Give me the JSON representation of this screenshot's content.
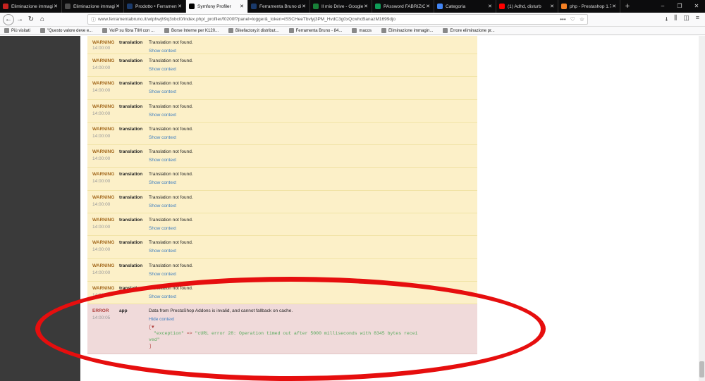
{
  "browser": {
    "tabs": [
      {
        "title": "Eliminazione immagini",
        "color": "#c5221f"
      },
      {
        "title": "Eliminazione immagini",
        "color": "#4b4b4b"
      },
      {
        "title": "Prodotto • Ferramenta",
        "color": "#1a3a6b"
      },
      {
        "title": "Symfony Profiler",
        "color": "#000000",
        "active": true
      },
      {
        "title": "Ferramenta Bruno di",
        "color": "#1a3a6b"
      },
      {
        "title": "Il mio Drive - Google",
        "color": "#188038"
      },
      {
        "title": "PAssword FABRIZIO",
        "color": "#0f9d58"
      },
      {
        "title": "Categoria",
        "color": "#4285f4"
      },
      {
        "title": "(1) Adhd, disturb",
        "color": "#ff0000"
      },
      {
        "title": "php - Prestashop 1.7",
        "color": "#f48024"
      }
    ],
    "new_tab": "+",
    "url": "www.ferramentabruno.it/wtphwjh9q3xbcl0/index.php/_profiler/f0200f?panel=logger&_token=iSSCHeeTbvlyj3PM_HvdC3g0xQcwhcBanazM1699djo",
    "url_actions": [
      "•••",
      "♡",
      "☆"
    ],
    "bookmarks": [
      "Più visitati",
      "\"Questo valore deve e...",
      "VoIP su fibra TIM con ...",
      "Borse Interne per K120...",
      "Bikefactory.it distribut...",
      "Ferramenta Bruno - 84...",
      "macos",
      "Eliminazione immagin...",
      "Errore eliminazione pr..."
    ]
  },
  "log": {
    "warnings": [
      {
        "level": "WARNING",
        "time": "14:00:00",
        "channel": "translation",
        "message": "Translation not found.",
        "context_link": "Show context"
      },
      {
        "level": "WARNING",
        "time": "14:00:00",
        "channel": "translation",
        "message": "Translation not found.",
        "context_link": "Show context"
      },
      {
        "level": "WARNING",
        "time": "14:00:00",
        "channel": "translation",
        "message": "Translation not found.",
        "context_link": "Show context"
      },
      {
        "level": "WARNING",
        "time": "14:00:00",
        "channel": "translation",
        "message": "Translation not found.",
        "context_link": "Show context"
      },
      {
        "level": "WARNING",
        "time": "14:00:00",
        "channel": "translation",
        "message": "Translation not found.",
        "context_link": "Show context"
      },
      {
        "level": "WARNING",
        "time": "14:00:00",
        "channel": "translation",
        "message": "Translation not found.",
        "context_link": "Show context"
      },
      {
        "level": "WARNING",
        "time": "14:00:00",
        "channel": "translation",
        "message": "Translation not found.",
        "context_link": "Show context"
      },
      {
        "level": "WARNING",
        "time": "14:00:00",
        "channel": "translation",
        "message": "Translation not found.",
        "context_link": "Show context"
      },
      {
        "level": "WARNING",
        "time": "14:00:00",
        "channel": "translation",
        "message": "Translation not found.",
        "context_link": "Show context"
      },
      {
        "level": "WARNING",
        "time": "14:00:00",
        "channel": "translation",
        "message": "Translation not found.",
        "context_link": "Show context"
      },
      {
        "level": "WARNING",
        "time": "14:00:00",
        "channel": "translation",
        "message": "Translation not found.",
        "context_link": "Show context"
      },
      {
        "level": "WARNING",
        "time": "14:00:00",
        "channel": "translation",
        "message": "Translation not found.",
        "context_link": "Show context"
      }
    ],
    "error": {
      "level": "ERROR",
      "time": "14:00:05",
      "channel": "app",
      "message": "Data from PrestaShop Addons is invalid, and cannot fallback on cache.",
      "context_link": "Hide context",
      "dump_open": "[▼",
      "dump_key": "\"exception\"",
      "dump_arrow": "=>",
      "dump_value_1": "\"cURL error 28: Operation timed out after 5000 milliseconds with 8345 bytes recei",
      "dump_value_2": "ved\"",
      "dump_close": "]"
    }
  },
  "colors": {
    "warning_bg": "#fcf0c8",
    "error_bg": "#f0dada",
    "warning_text": "#a46a1f",
    "error_text": "#b0413e",
    "link": "#3c7dc0",
    "annotation": "#e60e0e"
  }
}
